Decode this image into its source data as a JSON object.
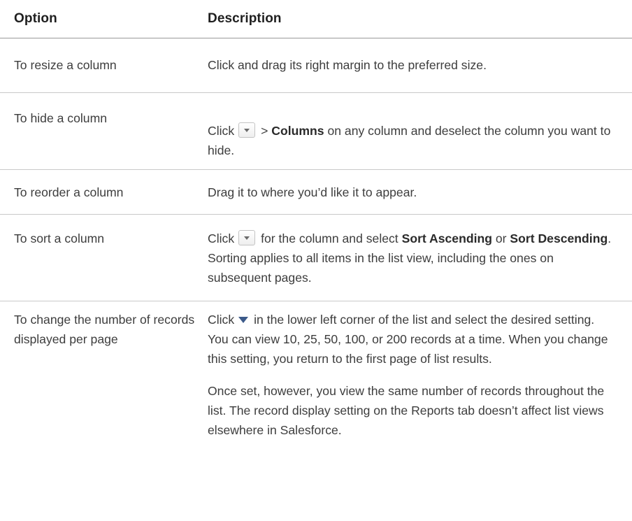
{
  "headers": {
    "option": "Option",
    "description": "Description"
  },
  "rows": [
    {
      "option": "To resize a column",
      "description": "Click and drag its right margin to the preferred size."
    },
    {
      "option": "To hide a column",
      "desc_click": "Click",
      "desc_gt": ">",
      "desc_bold": "Columns",
      "desc_rest": "on any column and deselect the column you want to hide."
    },
    {
      "option": "To reorder a column",
      "description": "Drag it to where you’d like it to appear."
    },
    {
      "option": "To sort a column",
      "desc_click": "Click",
      "desc_mid": "for the column and select",
      "desc_bold1": "Sort Ascending",
      "desc_or": "or",
      "desc_bold2": "Sort Descending",
      "desc_rest": ". Sorting applies to all items in the list view, including the ones on subsequent pages."
    },
    {
      "option": "To change the number of records displayed per page",
      "desc_click": "Click",
      "desc_rest": "in the lower left corner of the list and select the desired setting. You can view 10, 25, 50, 100, or 200 records at a time. When you change this setting, you return to the first page of list results.",
      "desc_para2": "Once set, however, you view the same number of records throughout the list. The record display setting on the Reports tab doesn’t affect list views elsewhere in Salesforce."
    }
  ],
  "icons": {
    "dropdown_button": "dropdown-arrow-icon",
    "records_triangle": "triangle-down-icon"
  }
}
